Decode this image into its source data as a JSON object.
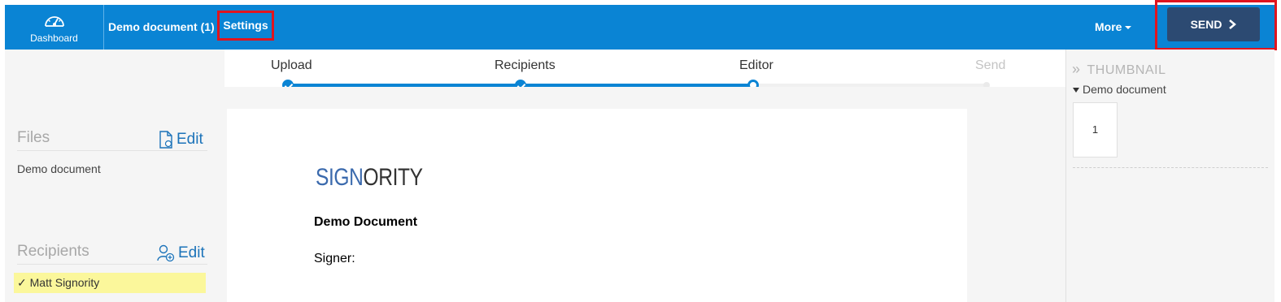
{
  "header": {
    "dashboard_label": "Dashboard",
    "document_title": "Demo document (1)",
    "settings_label": "Settings",
    "more_label": "More",
    "send_label": "SEND"
  },
  "steps": [
    {
      "label": "Upload",
      "state": "done"
    },
    {
      "label": "Recipients",
      "state": "done"
    },
    {
      "label": "Editor",
      "state": "current"
    },
    {
      "label": "Send",
      "state": "future"
    }
  ],
  "sidebar": {
    "files_title": "Files",
    "files_edit": "Edit",
    "files": [
      "Demo document"
    ],
    "recipients_title": "Recipients",
    "recipients_edit": "Edit",
    "recipients": [
      "✓ Matt Signority"
    ]
  },
  "document": {
    "logo_part1": "SIGN",
    "logo_part2": "ORITY",
    "heading": "Demo Document",
    "signer_label": "Signer:"
  },
  "thumbnail": {
    "title": "THUMBNAIL",
    "document_name": "Demo document",
    "pages": [
      "1"
    ]
  },
  "colors": {
    "header_blue": "#0a84d4",
    "send_button": "#2c4a72",
    "highlight_red": "#e0141e",
    "recipient_highlight": "#fbf79b",
    "logo_blue": "#3b6aad"
  }
}
